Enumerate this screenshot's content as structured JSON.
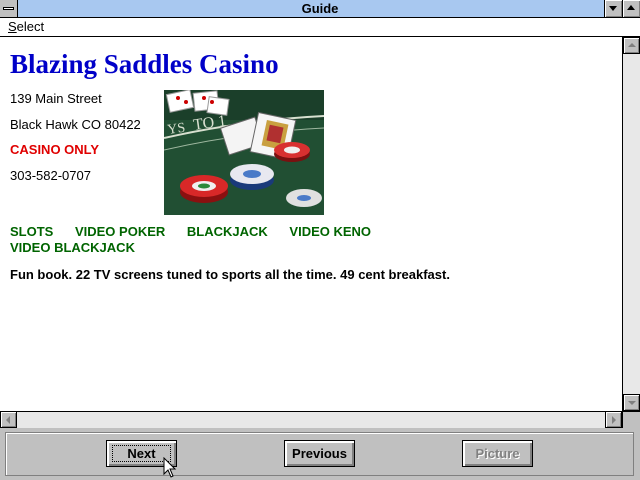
{
  "window": {
    "title": "Guide"
  },
  "menu": {
    "items": [
      {
        "label": "Select",
        "accel": "S",
        "rest": "elect"
      }
    ]
  },
  "listing": {
    "name": "Blazing Saddles Casino",
    "address_line1": "139 Main Street",
    "address_line2": "Black Hawk CO 80422",
    "note": "CASINO ONLY",
    "phone": "303-582-0707",
    "games": [
      "SLOTS",
      "VIDEO POKER",
      "BLACKJACK",
      "VIDEO KENO",
      "VIDEO BLACKJACK"
    ],
    "description": "Fun book.  22 TV screens tuned to sports all the time.  49 cent breakfast."
  },
  "buttons": {
    "next": "Next",
    "previous": "Previous",
    "picture": "Picture"
  },
  "colors": {
    "title_bar": "#a8c8f0",
    "casino_name": "#0000c8",
    "note": "#e00000",
    "games": "#006400"
  }
}
